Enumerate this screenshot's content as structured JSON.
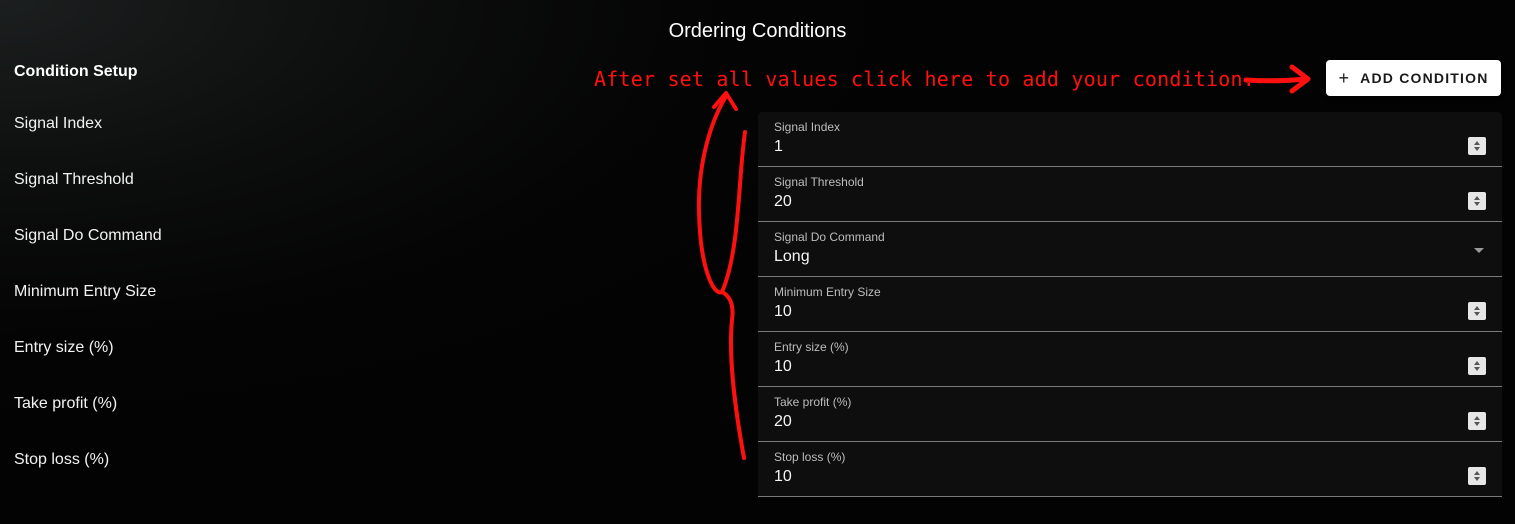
{
  "header": {
    "title": "Ordering Conditions"
  },
  "condition_setup": {
    "title": "Condition Setup",
    "labels": [
      "Signal Index",
      "Signal Threshold",
      "Signal Do Command",
      "Minimum Entry Size",
      "Entry size (%)",
      "Take profit (%)",
      "Stop loss (%)"
    ]
  },
  "annotation": {
    "text": "After set all values click here to add your condition.",
    "color": "#ff1010"
  },
  "add_button": {
    "icon": "plus-icon",
    "label": "ADD CONDITION"
  },
  "fields": [
    {
      "label": "Signal Index",
      "value": "1",
      "type": "number"
    },
    {
      "label": "Signal Threshold",
      "value": "20",
      "type": "number"
    },
    {
      "label": "Signal Do Command",
      "value": "Long",
      "type": "select"
    },
    {
      "label": "Minimum Entry Size",
      "value": "10",
      "type": "number"
    },
    {
      "label": "Entry size (%)",
      "value": "10",
      "type": "number"
    },
    {
      "label": "Take profit (%)",
      "value": "20",
      "type": "number"
    },
    {
      "label": "Stop loss (%)",
      "value": "10",
      "type": "number"
    }
  ]
}
